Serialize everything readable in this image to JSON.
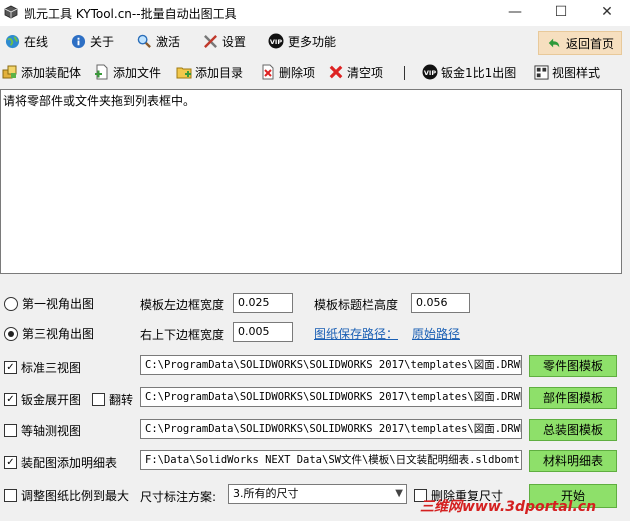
{
  "window": {
    "title": "凯元工具 KYTool.cn--批量自动出图工具",
    "min": "—",
    "max": "☐",
    "close": "✕"
  },
  "menu": {
    "online": "在线",
    "about": "关于",
    "activate": "激活",
    "settings": "设置",
    "more": "更多功能",
    "home": "返回首页"
  },
  "toolbar": {
    "add_assembly": "添加装配体",
    "add_file": "添加文件",
    "add_dir": "添加目录",
    "delete_item": "删除项",
    "clear_items": "清空项",
    "sheet_metal": "钣金1比1出图",
    "view_style": "视图样式"
  },
  "listbox": {
    "hint": "请将零部件或文件夹拖到列表框中。"
  },
  "form": {
    "first_angle": "第一视角出图",
    "third_angle": "第三视角出图",
    "left_margin_label": "模板左边框宽度",
    "left_margin_value": "0.025",
    "title_height_label": "模板标题栏高度",
    "title_height_value": "0.056",
    "top_margin_label": "右上下边框宽度",
    "top_margin_value": "0.005",
    "save_path_label": "图纸保存路径：",
    "save_path_value": "原始路径",
    "standard_views": "标准三视图",
    "standard_path": "C:\\ProgramData\\SOLIDWORKS\\SOLIDWORKS 2017\\templates\\図面.DRWDOT",
    "part_template_btn": "零件图模板",
    "flat_pattern": "钣金展开图",
    "flip": "翻转",
    "flat_path": "C:\\ProgramData\\SOLIDWORKS\\SOLIDWORKS 2017\\templates\\図面.DRWDOT",
    "component_template_btn": "部件图模板",
    "iso_view": "等轴测视图",
    "iso_path": "C:\\ProgramData\\SOLIDWORKS\\SOLIDWORKS 2017\\templates\\図面.DRWDOT",
    "assembly_template_btn": "总装图模板",
    "bom": "装配图添加明细表",
    "bom_path": "F:\\Data\\SolidWorks NEXT Data\\SW文件\\模板\\日文装配明细表.sldbomt",
    "bom_btn": "材料明细表",
    "scale_fit": "调整图纸比例到最大",
    "dim_label": "尺寸标注方案:",
    "dim_value": "3.所有的尺寸",
    "remove_dup": "删除重复尺寸",
    "start": "开始"
  },
  "watermark": "三维网www.3dportal.cn"
}
